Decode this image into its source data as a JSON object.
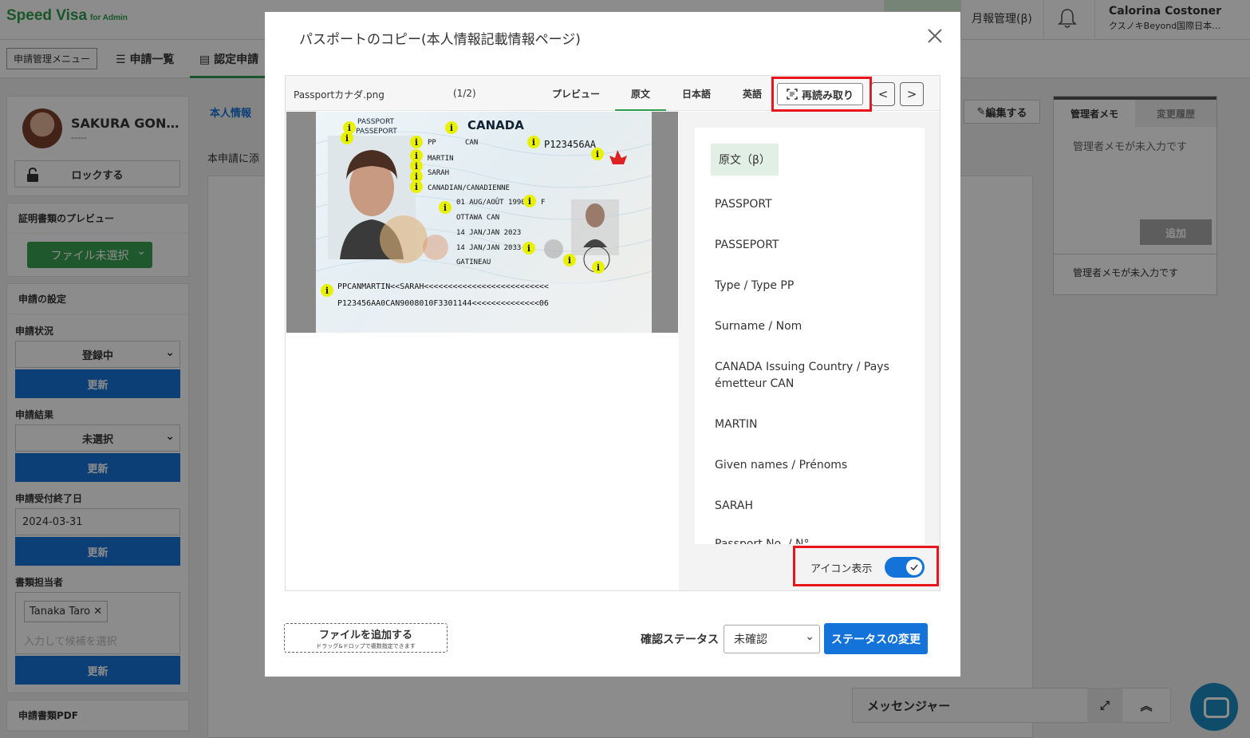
{
  "app": {
    "logo": "Speed Visa",
    "logo_sub": "for Admin",
    "report": "月報管理(β)",
    "user_name": "Calorina Costoner",
    "user_org": "クスノキBeyond国際日本…"
  },
  "subnav": {
    "menu": "申請管理メニュー",
    "list": "申請一覧",
    "cert": "認定申請"
  },
  "left": {
    "name": "SAKURA GON…",
    "name_sub": "-----",
    "lock": "ロックする",
    "preview_title": "証明書類のプレビュー",
    "file_select": "ファイル未選択",
    "settings_title": "申請の設定",
    "status_label": "申請状況",
    "status_value": "登録中",
    "result_label": "申請結果",
    "result_value": "未選択",
    "deadline_label": "申請受付終了日",
    "deadline_value": "2024-03-31",
    "owner_label": "書類担当者",
    "owner_tag": "Tanaka Taro",
    "owner_placeholder": "入力して候補を選択",
    "update": "更新",
    "pdf_title": "申請書類PDF"
  },
  "middle": {
    "tab": "本人情報",
    "intro": "本申請に添",
    "edit": "編集する"
  },
  "memo": {
    "tab_memo": "管理者メモ",
    "tab_history": "変更履歴",
    "empty": "管理者メモが未入力です",
    "add": "追加",
    "footer": "管理者メモが未入力です"
  },
  "messenger": {
    "label": "メッセンジャー"
  },
  "modal": {
    "title": "パスポートのコピー(本人情報記載情報ページ)",
    "file_name": "Passportカナダ.png",
    "page": "(1/2)",
    "tabs": [
      "プレビュー",
      "原文",
      "日本語",
      "英語"
    ],
    "active_tab": "原文",
    "reread": "再読み取り",
    "prev": "<",
    "next": ">",
    "ocr_badge": "原文（β）",
    "ocr_items": [
      "PASSPORT",
      "PASSEPORT",
      "Type / Type PP",
      "Surname / Nom",
      "CANADA Issuing Country / Pays émetteur CAN",
      "MARTIN",
      "Given names / Prénoms",
      "SARAH",
      "Passport No. / N°..."
    ],
    "toggle_label": "アイコン表示",
    "toggle_on": true,
    "add_file": "ファイルを追加する",
    "add_file_sub": "ドラッグ&ドロップで複数指定できます",
    "confirm_label": "確認ステータス",
    "confirm_value": "未確認",
    "status_button": "ステータスの変更"
  },
  "passport": {
    "header1": "PASSPORT",
    "header2": "PASSEPORT",
    "country": "CANADA",
    "type": "PP",
    "code": "CAN",
    "number": "P123456AA",
    "surname": "MARTIN",
    "given": "SARAH",
    "nationality": "CANADIAN/CANADIENNE",
    "dob": "01 AUG/AOÛT 1990",
    "sex": "F",
    "pob": "OTTAWA CAN",
    "issue": "14 JAN/JAN 2023",
    "expiry": "14 JAN/JAN 2033",
    "authority": "GATINEAU",
    "mrz1": "PPCANMARTIN<<SARAH<<<<<<<<<<<<<<<<<<<<<<<<<<",
    "mrz2": "P123456AA0CAN9008010F3301144<<<<<<<<<<<<<<06",
    "marker": "i"
  }
}
